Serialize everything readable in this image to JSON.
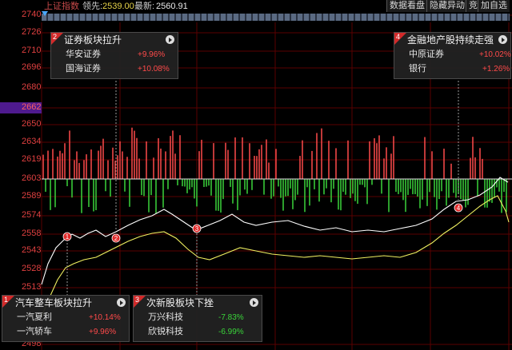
{
  "header": {
    "title": "上证指数",
    "lead_label": "领先:",
    "lead_value": "2539.00",
    "last_label": "最新:",
    "last_value": "2560.91",
    "buttons": [
      "数据看盘",
      "隐藏异动",
      "竞",
      "加自选"
    ]
  },
  "axis": {
    "ticks": [
      "2740",
      "2726",
      "2710",
      "2696",
      "2680",
      "2662",
      "2650",
      "2634",
      "2619",
      "2603",
      "2589",
      "2574",
      "2558",
      "2543",
      "2528",
      "2513",
      "2498"
    ],
    "highlight": "2662"
  },
  "colors": {
    "up": "#ff4a4a",
    "down": "#3ad43a",
    "accent": "#4e1a8e",
    "grid": "#5a0000",
    "white_line": "#ffffff",
    "yellow_line": "#f0f060"
  },
  "cards": [
    {
      "num": "2",
      "title": "证券板块拉升",
      "rows": [
        {
          "name": "华安证券",
          "pct": "+9.96%",
          "dir": "up"
        },
        {
          "name": "国海证券",
          "pct": "+10.08%",
          "dir": "up"
        }
      ]
    },
    {
      "num": "4",
      "title": "金融地产股持续走强",
      "rows": [
        {
          "name": "中原证券",
          "pct": "+10.02%",
          "dir": "up"
        },
        {
          "name": "银行",
          "pct": "+1.26%",
          "dir": "up"
        }
      ]
    },
    {
      "num": "1",
      "title": "汽车整车板块拉升",
      "rows": [
        {
          "name": "一汽夏利",
          "pct": "+10.14%",
          "dir": "up"
        },
        {
          "name": "一汽轿车",
          "pct": "+9.96%",
          "dir": "up"
        }
      ]
    },
    {
      "num": "3",
      "title": "次新股板块下挫",
      "rows": [
        {
          "name": "万兴科技",
          "pct": "-7.83%",
          "dir": "down"
        },
        {
          "name": "欣锐科技",
          "pct": "-6.99%",
          "dir": "down"
        }
      ]
    }
  ],
  "markers": [
    "1",
    "2",
    "3",
    "4"
  ]
}
